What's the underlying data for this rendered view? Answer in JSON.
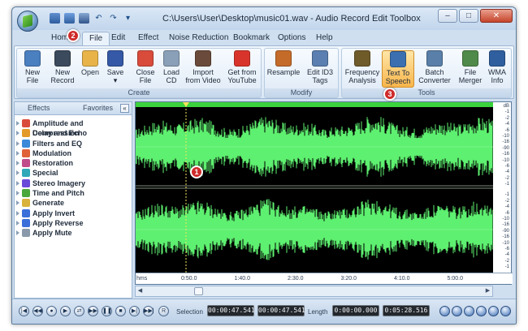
{
  "window": {
    "title": "C:\\Users\\User\\Desktop\\music01.wav - Audio Record Edit Toolbox"
  },
  "menu": {
    "tabs": [
      {
        "label": "Home"
      },
      {
        "label": "File"
      },
      {
        "label": "Edit"
      },
      {
        "label": "Effect"
      },
      {
        "label": "Noise Reduction"
      },
      {
        "label": "Bookmark"
      },
      {
        "label": "Options"
      },
      {
        "label": "Help"
      }
    ],
    "active": "File"
  },
  "ribbon": {
    "groups": [
      {
        "label": "Create",
        "buttons": [
          {
            "line1": "New",
            "line2": "File",
            "icon": "new-file-icon",
            "color": "#4a7fc0"
          },
          {
            "line1": "New",
            "line2": "Record",
            "icon": "microphone-icon",
            "color": "#3b4a5c"
          },
          {
            "line1": "Open",
            "line2": "",
            "icon": "folder-open-icon",
            "color": "#e8b44a"
          },
          {
            "line1": "Save",
            "line2": "",
            "icon": "save-icon",
            "color": "#3559a6"
          },
          {
            "line1": "Close",
            "line2": "File",
            "icon": "close-file-icon",
            "color": "#d94b3b"
          },
          {
            "line1": "Load",
            "line2": "CD",
            "icon": "cd-icon",
            "color": "#8aa0b8"
          },
          {
            "line1": "Import",
            "line2": "from Video",
            "icon": "film-icon",
            "color": "#6a4a3a"
          },
          {
            "line1": "Get from",
            "line2": "YouTube",
            "icon": "youtube-icon",
            "color": "#d9342b"
          }
        ]
      },
      {
        "label": "Modify",
        "buttons": [
          {
            "line1": "Resample",
            "line2": "",
            "icon": "resample-icon",
            "color": "#c56b2a"
          },
          {
            "line1": "Edit ID3",
            "line2": "Tags",
            "icon": "tag-icon",
            "color": "#5a7fb0"
          }
        ]
      },
      {
        "label": "Tools",
        "buttons": [
          {
            "line1": "Frequency",
            "line2": "Analysis",
            "icon": "spectrum-icon",
            "color": "#6f5a2a"
          },
          {
            "line1": "Text To",
            "line2": "Speech",
            "icon": "speaker-person-icon",
            "color": "#3b6fb0"
          },
          {
            "line1": "Batch",
            "line2": "Converter",
            "icon": "batch-icon",
            "color": "#5a7fa8"
          },
          {
            "line1": "File",
            "line2": "Merger",
            "icon": "merge-icon",
            "color": "#4f8a4a"
          },
          {
            "line1": "WMA",
            "line2": "Info",
            "icon": "info-icon",
            "color": "#2f5f9e"
          }
        ]
      }
    ],
    "active_button": "Text To Speech"
  },
  "sidepanel": {
    "tabs": [
      "Effects",
      "Favorites"
    ],
    "collapse_glyph": "«",
    "items": [
      {
        "label": "Amplitude and Compression",
        "color": "#d94b3b"
      },
      {
        "label": "Delay and Echo",
        "color": "#e39a2a"
      },
      {
        "label": "Filters and EQ",
        "color": "#3b8ad9"
      },
      {
        "label": "Modulation",
        "color": "#e0623a"
      },
      {
        "label": "Restoration",
        "color": "#c04a8a"
      },
      {
        "label": "Special",
        "color": "#2fa8b8"
      },
      {
        "label": "Stereo Imagery",
        "color": "#6a4ad9"
      },
      {
        "label": "Time and Pitch",
        "color": "#4aa83b"
      },
      {
        "label": "Generate",
        "color": "#d9b23b"
      },
      {
        "label": "Apply Invert",
        "color": "#3b6fd9"
      },
      {
        "label": "Apply Reverse",
        "color": "#3b6fd9"
      },
      {
        "label": "Apply Mute",
        "color": "#8a9aaa"
      }
    ]
  },
  "wave": {
    "color": "#5ef070",
    "db_labels": [
      "dB",
      "-1",
      "-2",
      "-4",
      "-6",
      "-10",
      "-16",
      "-90",
      "-16",
      "-10",
      "-6",
      "-4",
      "-2",
      "-1"
    ],
    "timeline": {
      "unit": "hms",
      "ticks": [
        "0:50.0",
        "1:40.0",
        "2:30.0",
        "3:20.0",
        "4:10.0",
        "5:00.0"
      ]
    }
  },
  "transport": {
    "buttons": [
      "|◀",
      "◀◀",
      "●",
      "▶",
      "⇄",
      "▶▶",
      "❚❚",
      "■",
      "▶|",
      "▶▶|"
    ],
    "r_label": "R"
  },
  "selection": {
    "label": "Selection",
    "start": "00:00:47.541",
    "end": "00:00:47.541"
  },
  "length": {
    "label": "Length",
    "start": "0:00:00.000",
    "end": "0:05:28.516"
  },
  "callouts": [
    "1",
    "2",
    "3"
  ]
}
